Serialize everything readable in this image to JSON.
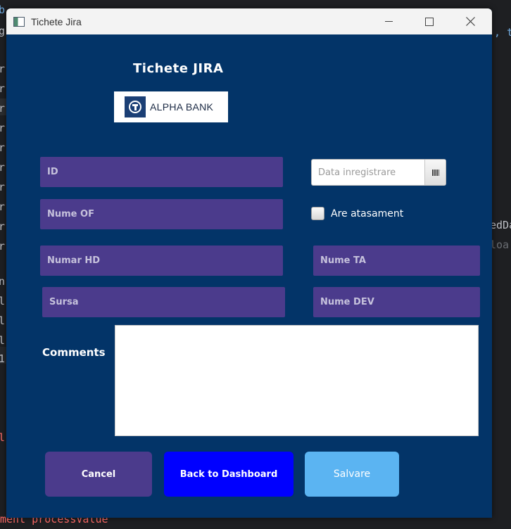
{
  "window": {
    "title": "Tichete Jira"
  },
  "background_ide": {
    "left_gutter_chars": [
      "b",
      "g",
      "r",
      "r",
      "r",
      "r",
      "r",
      "r",
      "r",
      "r",
      "r",
      "r",
      "n",
      "l",
      "l",
      "l",
      "l",
      "1"
    ],
    "right_snippets": [
      ", t",
      "edDa",
      "loa"
    ],
    "bottom_text": "ment processValue"
  },
  "form": {
    "heading": "Tichete JIRA",
    "logo_text": "ALPHA BANK",
    "fields": {
      "id": "ID",
      "nume_of": "Nume OF",
      "numar_hd": "Numar HD",
      "sursa": "Sursa",
      "nume_ta": "Nume TA",
      "nume_dev": "Nume DEV"
    },
    "date_placeholder": "Data inregistrare",
    "checkbox_label": "Are atasament",
    "comments_label": "Comments",
    "comments_value": ""
  },
  "buttons": {
    "cancel": "Cancel",
    "back": "Back to Dashboard",
    "save": "Salvare"
  },
  "colors": {
    "window_bg": "#033468",
    "field_bg": "#4b3b8c",
    "back_button": "#0000ff",
    "save_button": "#5bb4f2"
  }
}
